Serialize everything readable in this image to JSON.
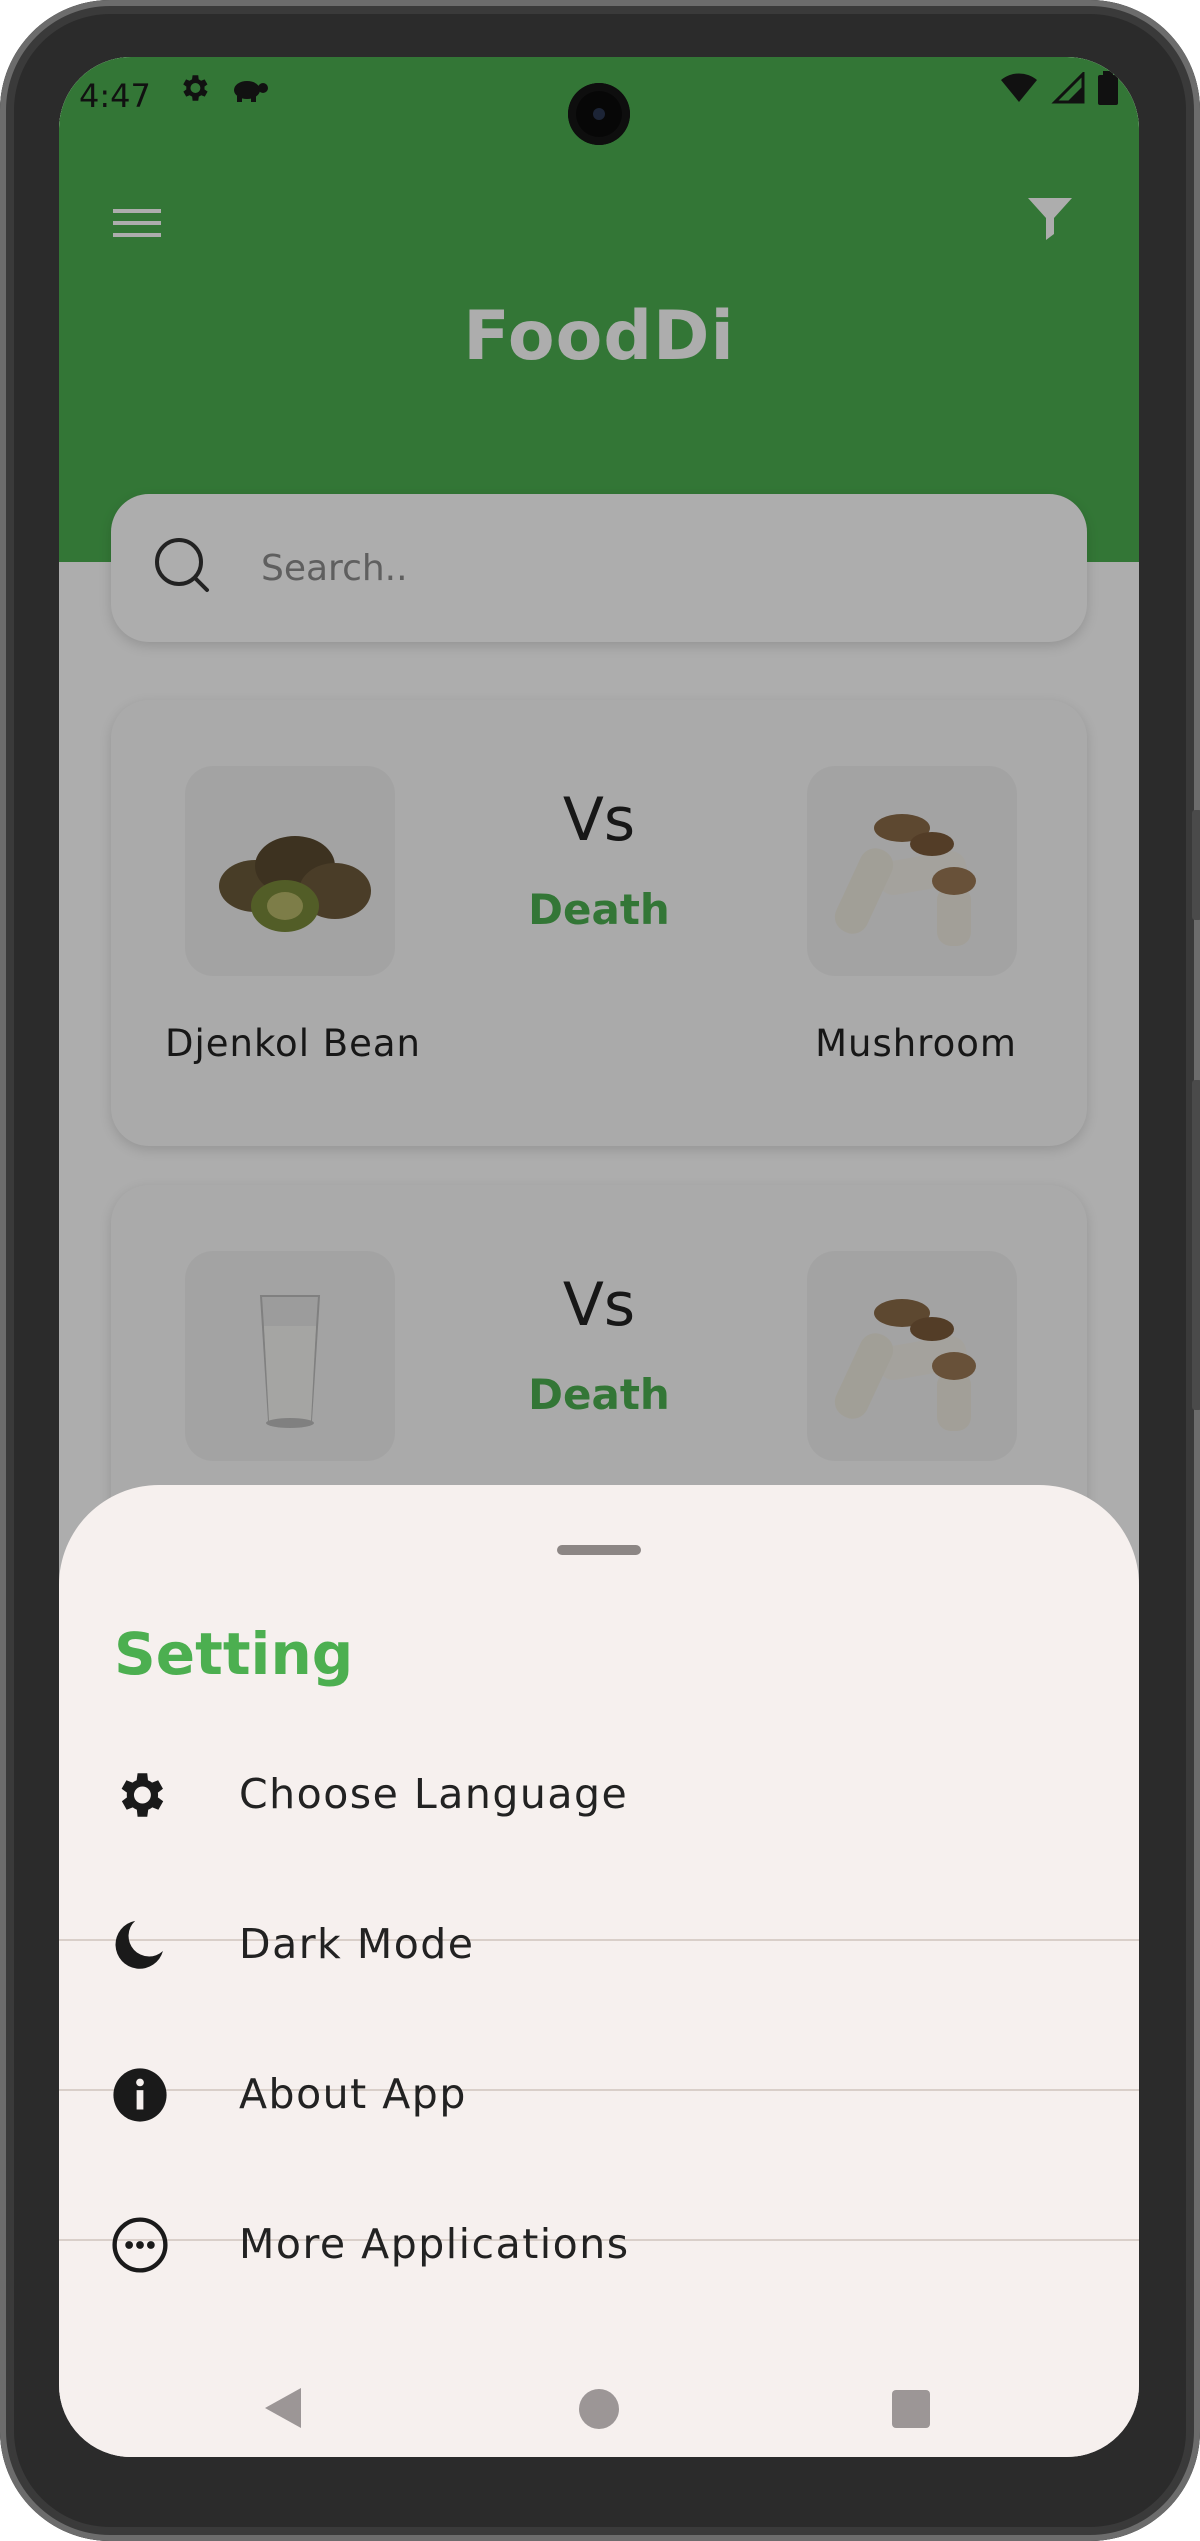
{
  "status_bar": {
    "time": "4:47"
  },
  "app": {
    "title": "FoodDi",
    "header_color": "#4caf50",
    "search_placeholder": "Search.."
  },
  "comparisons": [
    {
      "left_food": "Djenkol Bean",
      "vs_label": "Vs",
      "outcome": "Death",
      "right_food": "Mushroom",
      "left_icon": "djenkol-bean-image",
      "right_icon": "mushroom-image"
    },
    {
      "left_food": "",
      "vs_label": "Vs",
      "outcome": "Death",
      "right_food": "",
      "left_icon": "milk-glass-image",
      "right_icon": "mushroom-image"
    }
  ],
  "sheet": {
    "title": "Setting",
    "items": [
      {
        "label": "Choose Language",
        "icon": "gear-icon"
      },
      {
        "label": "Dark Mode",
        "icon": "moon-icon"
      },
      {
        "label": "About App",
        "icon": "info-icon"
      },
      {
        "label": "More Applications",
        "icon": "more-horizontal-icon"
      }
    ]
  },
  "colors": {
    "accent": "#4caf50",
    "sheet_bg": "#f6f0ee",
    "scrim": "rgba(0,0,0,0.32)"
  }
}
